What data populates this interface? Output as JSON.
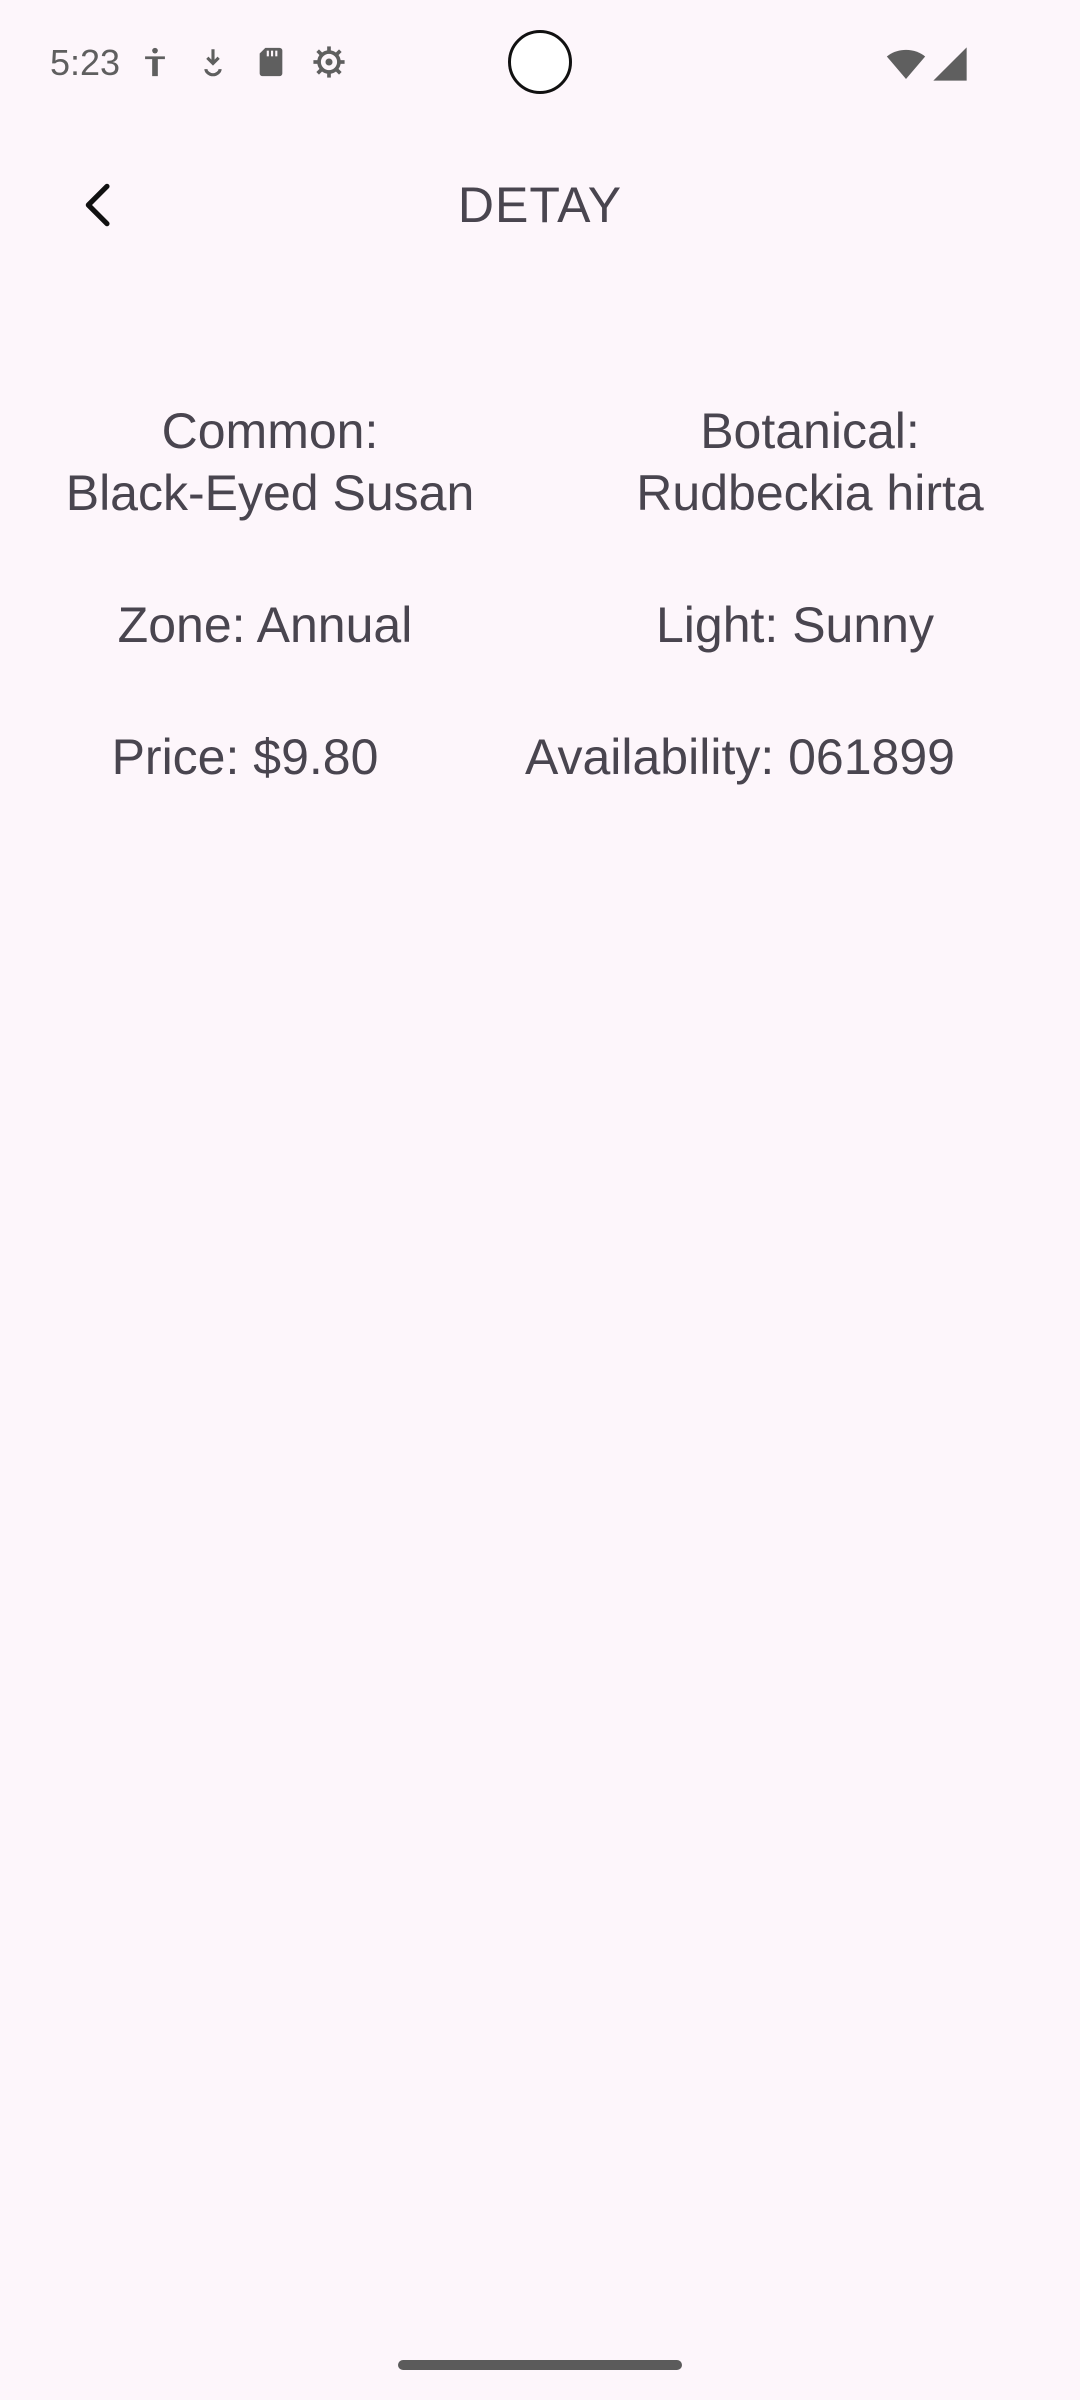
{
  "status_bar": {
    "time": "5:23",
    "left_icons": [
      "accessibility-icon",
      "download-icon",
      "sd-card-icon",
      "settings-gear-icon"
    ],
    "right_icons": [
      "wifi-icon",
      "cellular-signal-icon"
    ]
  },
  "app_bar": {
    "title": "DETAY",
    "back_icon": "chevron-left-icon"
  },
  "details": {
    "common_label": "Common:",
    "common_value": "Black-Eyed Susan",
    "botanical_label": "Botanical:",
    "botanical_value": "Rudbeckia hirta",
    "zone": "Zone: Annual",
    "light": "Light: Sunny",
    "price": "Price: $9.80",
    "availability": "Availability: 061899"
  },
  "colors": {
    "background": "#fdf6fb",
    "text": "#49454f"
  }
}
